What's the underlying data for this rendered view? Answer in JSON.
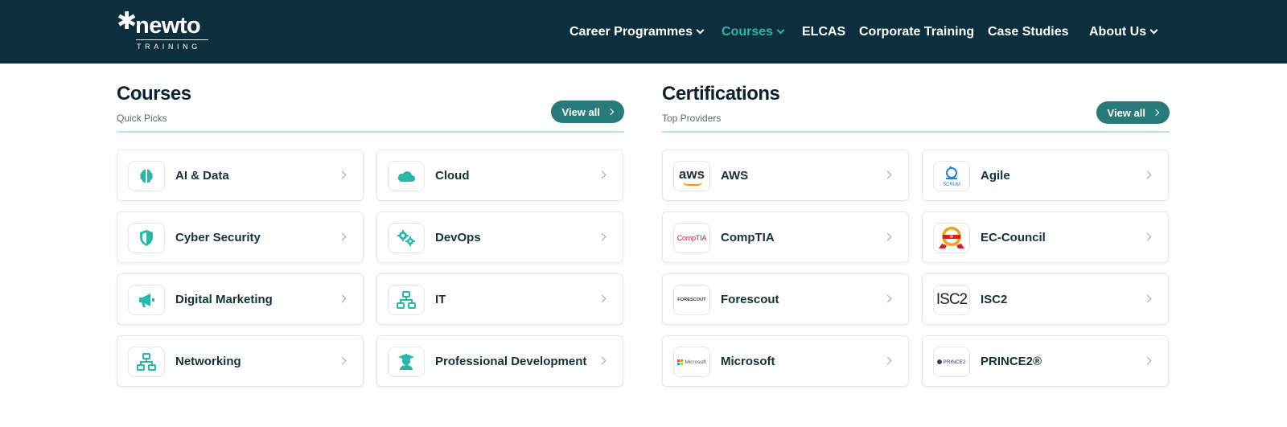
{
  "header": {
    "logo_word": "newto",
    "logo_sub": "TRAINING",
    "nav": [
      {
        "label": "Career Programmes",
        "dropdown": true,
        "active": false
      },
      {
        "label": "Courses",
        "dropdown": true,
        "active": true
      },
      {
        "label": "ELCAS",
        "dropdown": false,
        "active": false
      },
      {
        "label": "Corporate Training",
        "dropdown": false,
        "active": false
      },
      {
        "label": "Case Studies",
        "dropdown": false,
        "active": false
      },
      {
        "label": "About Us",
        "dropdown": true,
        "active": false
      }
    ]
  },
  "courses": {
    "title": "Courses",
    "subtitle": "Quick Picks",
    "view_all": "View all",
    "items": [
      {
        "label": "AI & Data",
        "icon": "brain-icon"
      },
      {
        "label": "Cloud",
        "icon": "cloud-icon"
      },
      {
        "label": "Cyber Security",
        "icon": "shield-icon"
      },
      {
        "label": "DevOps",
        "icon": "gears-icon"
      },
      {
        "label": "Digital Marketing",
        "icon": "megaphone-icon"
      },
      {
        "label": "IT",
        "icon": "network-icon"
      },
      {
        "label": "Networking",
        "icon": "network-icon"
      },
      {
        "label": "Professional Development",
        "icon": "graduate-icon"
      }
    ]
  },
  "certifications": {
    "title": "Certifications",
    "subtitle": "Top Providers",
    "view_all": "View all",
    "items": [
      {
        "label": "AWS",
        "logo_text": "aws"
      },
      {
        "label": "Agile",
        "logo_text": "SCRUM"
      },
      {
        "label": "CompTIA",
        "logo_text": "CompTIA"
      },
      {
        "label": "EC-Council",
        "logo_text": ""
      },
      {
        "label": "Forescout",
        "logo_text": "FORESCOUT"
      },
      {
        "label": "ISC2",
        "logo_text": "ISC2"
      },
      {
        "label": "Microsoft",
        "logo_text": "Microsoft"
      },
      {
        "label": "PRINCE2®",
        "logo_text": "PRINCE2"
      }
    ]
  },
  "colors": {
    "header_bg": "#0d2f3d",
    "accent": "#2bb6a8",
    "button": "#2a7a7c"
  }
}
